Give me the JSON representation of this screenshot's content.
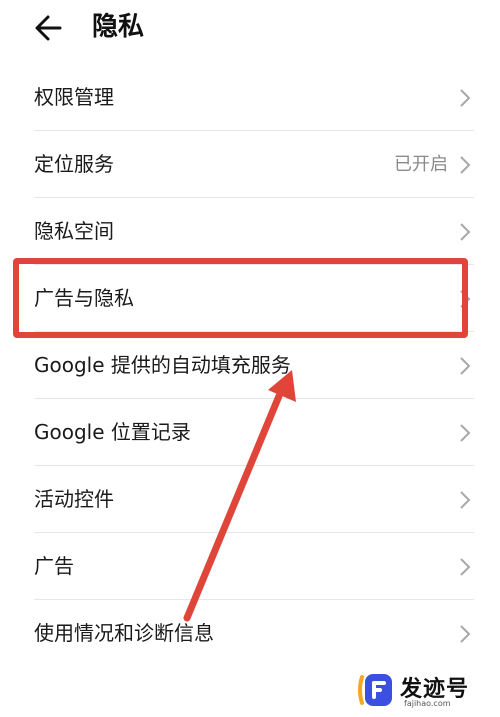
{
  "header": {
    "title": "隐私",
    "back_icon": "arrow-left-icon"
  },
  "list": {
    "items": [
      {
        "label": "权限管理",
        "value": ""
      },
      {
        "label": "定位服务",
        "value": "已开启"
      },
      {
        "label": "隐私空间",
        "value": ""
      },
      {
        "label": "广告与隐私",
        "value": ""
      },
      {
        "label": "Google 提供的自动填充服务",
        "value": ""
      },
      {
        "label": "Google 位置记录",
        "value": ""
      },
      {
        "label": "活动控件",
        "value": ""
      },
      {
        "label": "广告",
        "value": ""
      },
      {
        "label": "使用情况和诊断信息",
        "value": ""
      }
    ],
    "chevron_icon": "chevron-right-icon"
  },
  "annotation": {
    "color": "#e0453a",
    "highlight_target": "广告与隐私"
  },
  "watermark": {
    "name": "发迹号",
    "url": "fajihao.com"
  }
}
